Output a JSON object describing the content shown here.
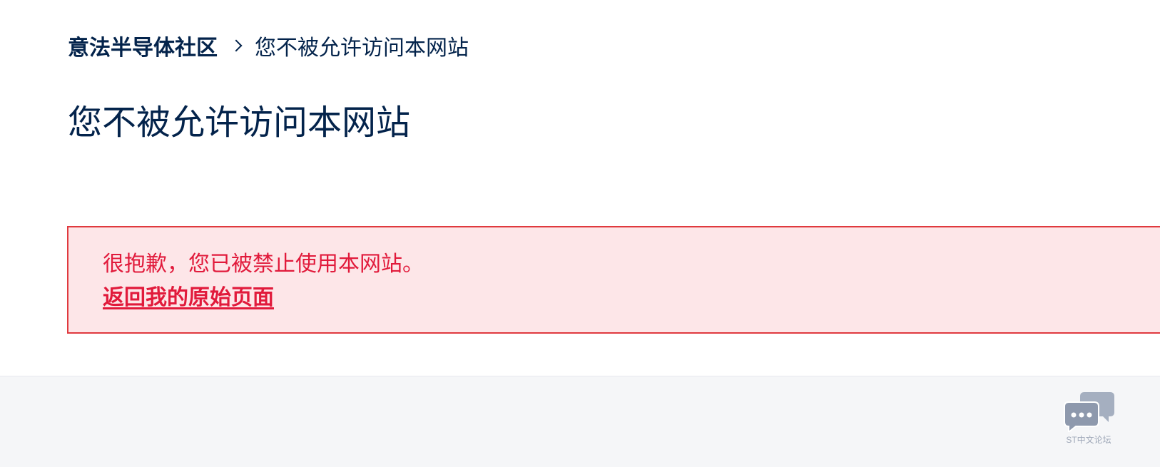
{
  "breadcrumb": {
    "home_label": "意法半导体社区",
    "current_label": "您不被允许访问本网站"
  },
  "page": {
    "title": "您不被允许访问本网站"
  },
  "alert": {
    "message": "很抱歉，您已被禁止使用本网站。",
    "link_label": "返回我的原始页面",
    "colors": {
      "background": "#fde6e8",
      "border": "#e0393e",
      "text": "#e11a3b"
    }
  },
  "chat_widget": {
    "icon": "chat-bubbles-icon",
    "label": "ST中文论坛"
  },
  "colors": {
    "primary_text": "#03234b",
    "footer_background": "#f5f6f8"
  }
}
